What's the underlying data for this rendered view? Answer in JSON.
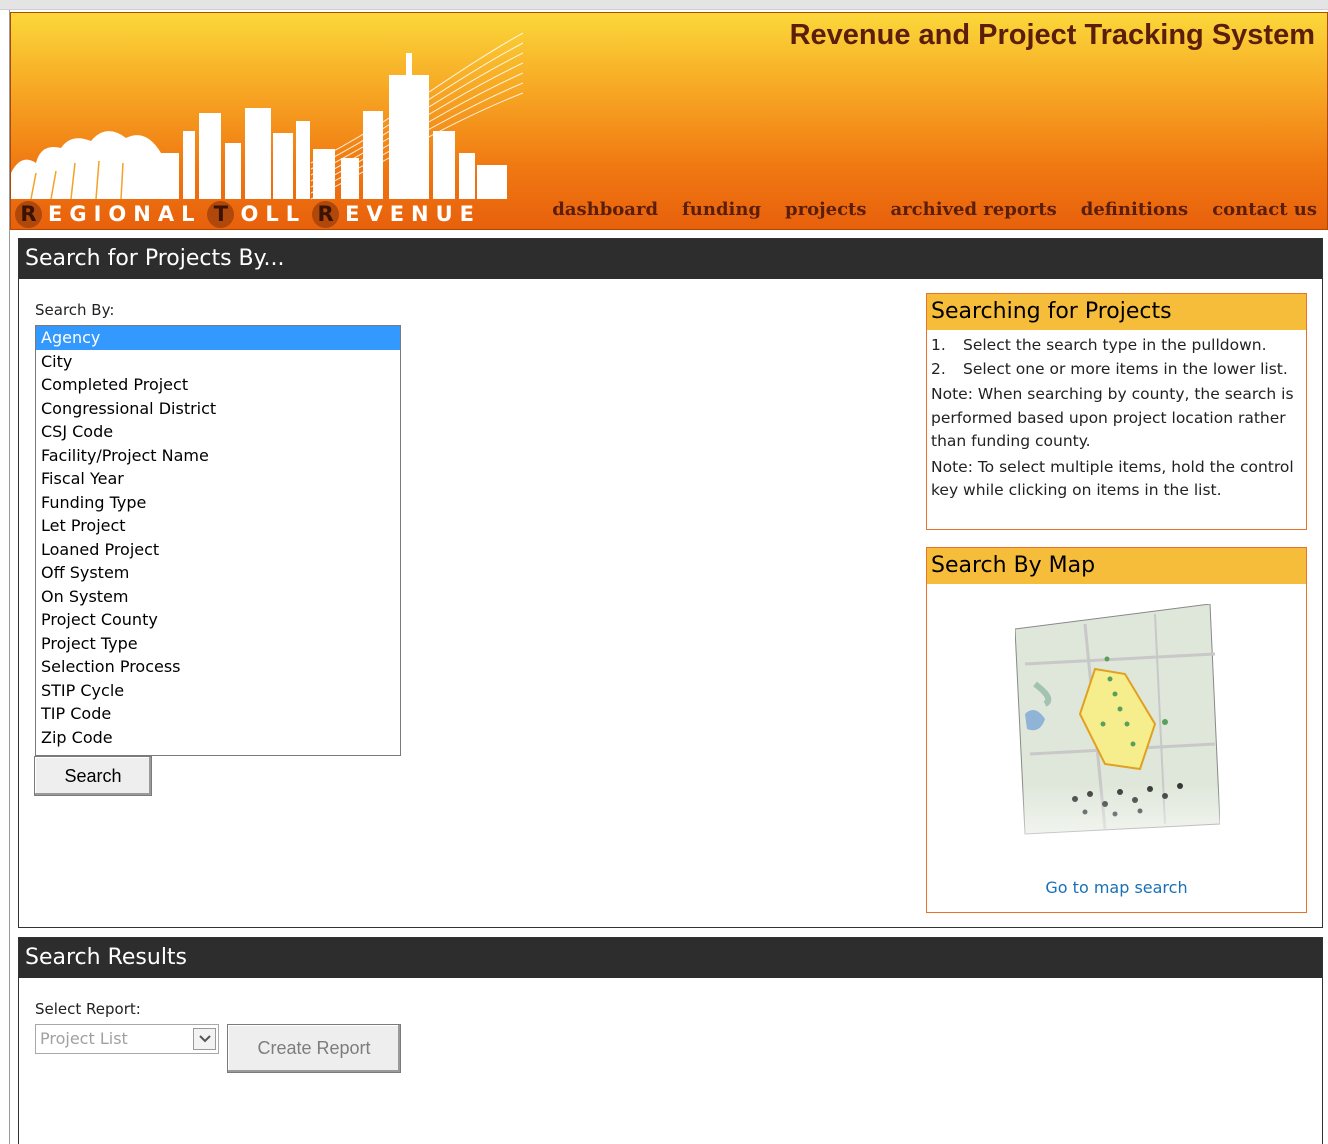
{
  "header": {
    "app_title": "Revenue and Project Tracking System",
    "logo": {
      "letters": "REGIONALTOLLREVENUE",
      "parts": [
        {
          "cap": "R",
          "rest": "EGIONAL"
        },
        {
          "cap": "T",
          "rest": "OLL"
        },
        {
          "cap": "R",
          "rest": "EVENUE"
        }
      ]
    },
    "nav": [
      "dashboard",
      "funding",
      "projects",
      "archived reports",
      "definitions",
      "contact us"
    ]
  },
  "search_panel": {
    "title": "Search for Projects By...",
    "search_by_label": "Search By:",
    "options": [
      "Agency",
      "City",
      "Completed Project",
      "Congressional District",
      "CSJ Code",
      "Facility/Project Name",
      "Fiscal Year",
      "Funding Type",
      "Let Project",
      "Loaned Project",
      "Off System",
      "On System",
      "Project County",
      "Project Type",
      "Selection Process",
      "STIP Cycle",
      "TIP Code",
      "Zip Code"
    ],
    "selected_option": "Agency",
    "search_button": "Search"
  },
  "help_box": {
    "title": "Searching for Projects",
    "steps": [
      {
        "num": "1.",
        "text": "Select the search type in the pulldown."
      },
      {
        "num": "2.",
        "text": "Select one or more items in the lower list."
      }
    ],
    "notes": [
      "Note: When searching by county, the search is performed based upon project location rather than funding county.",
      "Note: To select multiple items, hold the control key while clicking on items in the list."
    ]
  },
  "map_box": {
    "title": "Search By Map",
    "link": "Go to map search"
  },
  "results_panel": {
    "title": "Search Results",
    "select_report_label": "Select Report:",
    "select_report_value": "Project List",
    "create_report_button": "Create Report"
  },
  "colors": {
    "header_dark_text": "#5a1e0a",
    "panel_header_bg": "#2d2d2d",
    "infobox_header_bg": "#f6bd3a",
    "infobox_border": "#e8722a",
    "selection": "#3399ff",
    "link": "#1a6fb5"
  }
}
